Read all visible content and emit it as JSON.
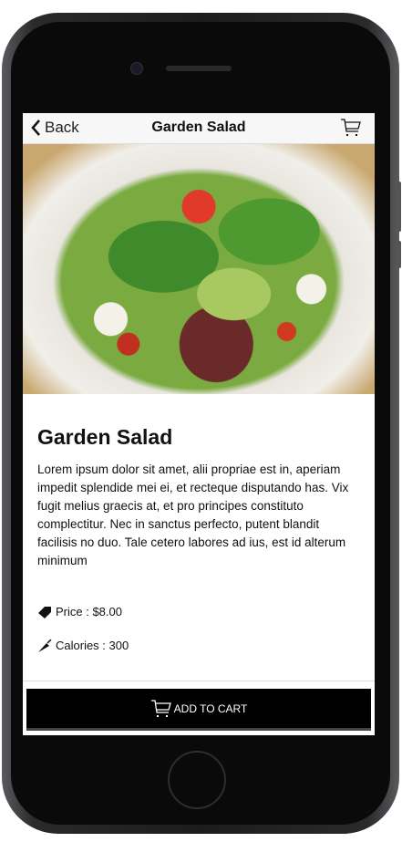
{
  "navbar": {
    "back_label": "Back",
    "title": "Garden Salad",
    "cart_icon": "cart-icon"
  },
  "product": {
    "name": "Garden Salad",
    "description": "Lorem ipsum dolor sit amet, alii propriae est in, aperiam impedit splendide mei ei, et recteque disputando has. Vix fugit melius graecis at, et pro principes constituto complectitur. Nec in sanctus perfecto, putent blandit facilisis no duo. Tale cetero labores ad ius, est id alterum minimum",
    "price_label": "Price : $8.00",
    "calories_label": "Calories : 300"
  },
  "actions": {
    "add_to_cart_label": "ADD TO CART"
  },
  "colors": {
    "button_bg": "#000000",
    "navbar_bg": "#f7f7f7"
  }
}
